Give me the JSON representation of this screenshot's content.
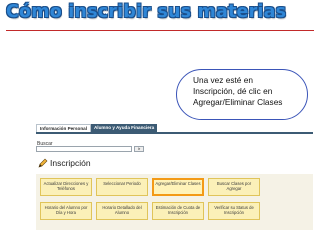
{
  "title": "Cómo inscribir sus materias",
  "callout": {
    "lines": [
      "Una vez esté en",
      "Inscripción, dé clic en",
      "Agregar/Eliminar Clases"
    ]
  },
  "tabs": [
    {
      "label": "Información Personal",
      "active": true
    },
    {
      "label": "Alumno y Ayuda Financiera",
      "active": false
    }
  ],
  "search": {
    "label": "Buscar",
    "go": "Ir"
  },
  "section": {
    "title": "Inscripción",
    "icon": "pencil-icon"
  },
  "menu": [
    {
      "lines": [
        "Actualizar Direcciones y",
        "Teléfonos"
      ]
    },
    {
      "lines": [
        "Seleccionar Periodo"
      ]
    },
    {
      "lines": [
        "Agregar/Eliminar Clases"
      ],
      "selected": true
    },
    {
      "lines": [
        "Buscar Clases por",
        "Agregar"
      ]
    },
    {
      "lines": [
        "Horario del Alumno por",
        "Día y Hora"
      ]
    },
    {
      "lines": [
        "Horario Detallado del",
        "Alumno"
      ]
    },
    {
      "lines": [
        "Estimación de Cuota de",
        "Inscripción"
      ]
    },
    {
      "lines": [
        "Verificar su Status de",
        "Inscripción"
      ]
    }
  ],
  "colors": {
    "title": "#2f86d6",
    "rule": "#c22a2a",
    "tab_dark": "#3c5b74",
    "selected_border": "#f39a16"
  }
}
